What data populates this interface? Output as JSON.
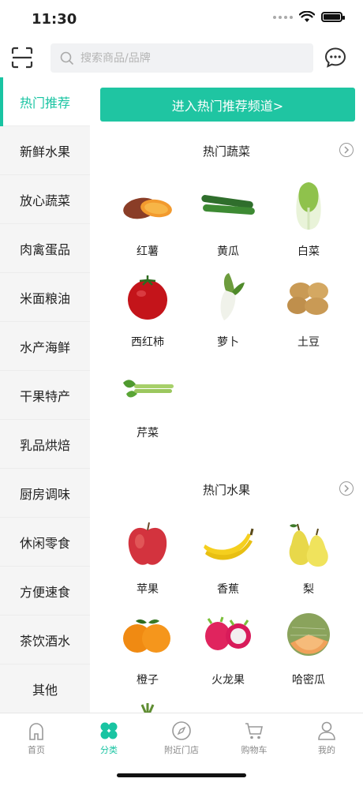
{
  "status_bar": {
    "time": "11:30"
  },
  "search": {
    "placeholder": "搜索商品/品牌"
  },
  "sidebar": {
    "items": [
      {
        "label": "热门推荐"
      },
      {
        "label": "新鲜水果"
      },
      {
        "label": "放心蔬菜"
      },
      {
        "label": "肉禽蛋品"
      },
      {
        "label": "米面粮油"
      },
      {
        "label": "水产海鲜"
      },
      {
        "label": "干果特产"
      },
      {
        "label": "乳品烘焙"
      },
      {
        "label": "厨房调味"
      },
      {
        "label": "休闲零食"
      },
      {
        "label": "方便速食"
      },
      {
        "label": "茶饮酒水"
      },
      {
        "label": "其他"
      }
    ],
    "selected": "热门推荐"
  },
  "banner": {
    "label": "进入热门推荐频道>"
  },
  "sections": [
    {
      "title": "热门蔬菜",
      "items": [
        {
          "name": "红薯",
          "icon": "sweet-potato"
        },
        {
          "name": "黄瓜",
          "icon": "cucumber"
        },
        {
          "name": "白菜",
          "icon": "napa-cabbage"
        },
        {
          "name": "西红柿",
          "icon": "tomato"
        },
        {
          "name": "萝卜",
          "icon": "radish"
        },
        {
          "name": "土豆",
          "icon": "potato"
        },
        {
          "name": "芹菜",
          "icon": "celery"
        }
      ]
    },
    {
      "title": "热门水果",
      "items": [
        {
          "name": "苹果",
          "icon": "apple"
        },
        {
          "name": "香蕉",
          "icon": "banana"
        },
        {
          "name": "梨",
          "icon": "pear"
        },
        {
          "name": "橙子",
          "icon": "orange"
        },
        {
          "name": "火龙果",
          "icon": "dragon-fruit"
        },
        {
          "name": "哈密瓜",
          "icon": "hami-melon"
        }
      ]
    }
  ],
  "tabbar": {
    "items": [
      {
        "label": "首页",
        "icon": "home-icon"
      },
      {
        "label": "分类",
        "icon": "category-icon"
      },
      {
        "label": "附近门店",
        "icon": "compass-icon"
      },
      {
        "label": "购物车",
        "icon": "cart-icon"
      },
      {
        "label": "我的",
        "icon": "profile-icon"
      }
    ],
    "active": "分类"
  },
  "colors": {
    "accent": "#19c4a2",
    "banner": "#1fc5a2"
  }
}
